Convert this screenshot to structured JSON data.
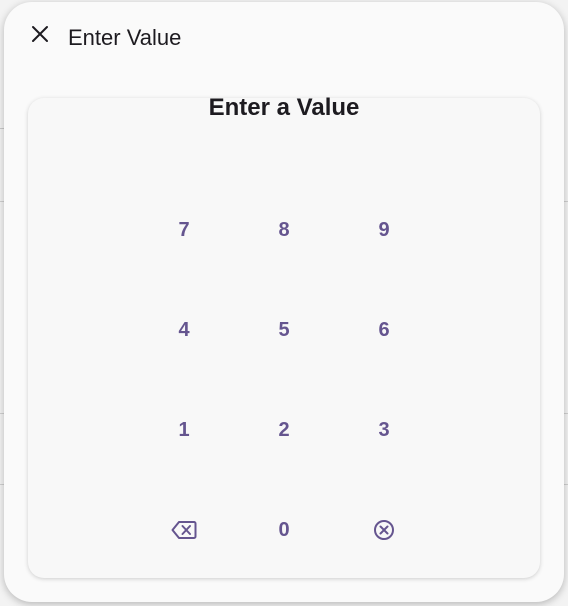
{
  "dialog": {
    "title": "Enter Value",
    "close_icon": "close-icon"
  },
  "card": {
    "title": "Enter a Value"
  },
  "keypad": {
    "rows": [
      [
        "7",
        "8",
        "9"
      ],
      [
        "4",
        "5",
        "6"
      ],
      [
        "1",
        "2",
        "3"
      ]
    ],
    "bottom": {
      "backspace_icon": "backspace-icon",
      "zero": "0",
      "clear_icon": "clear-circle-icon"
    }
  },
  "colors": {
    "accent": "#65558f",
    "text": "#1d1b20",
    "surface": "#fafafa"
  }
}
